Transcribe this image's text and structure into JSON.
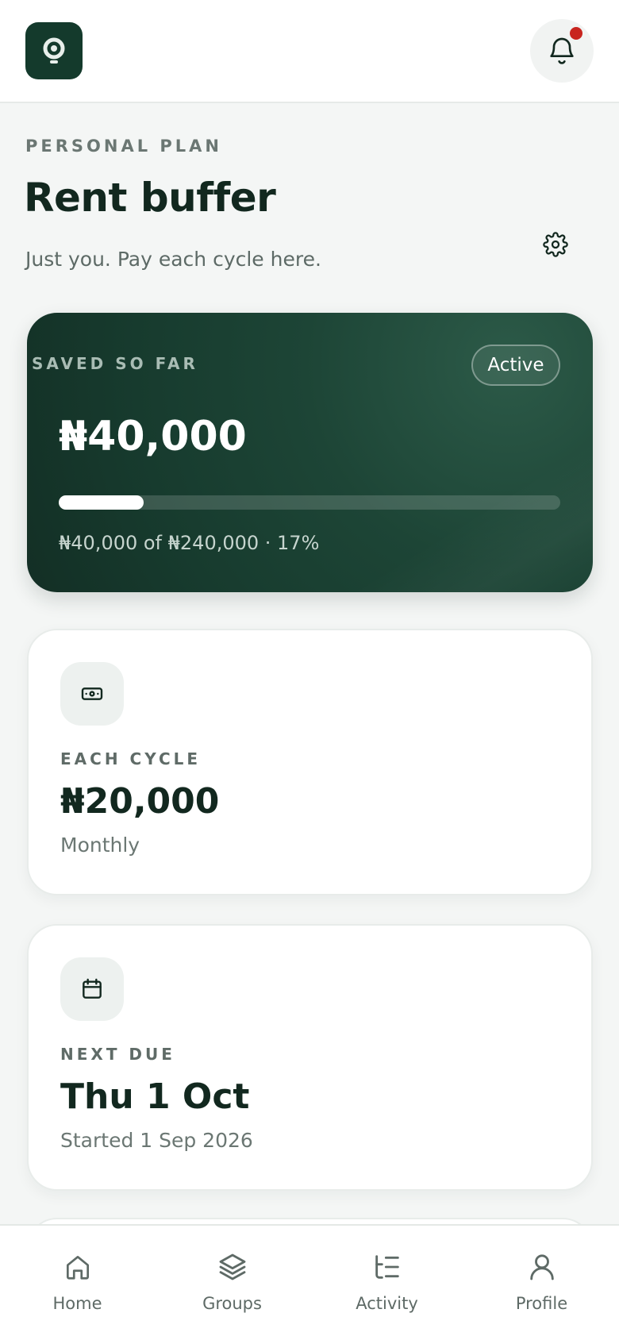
{
  "header": {
    "logo_icon": "app-logo-icon",
    "notification_icon": "bell-icon",
    "has_unread": true
  },
  "plan": {
    "eyebrow": "PERSONAL PLAN",
    "title": "Rent buffer",
    "subtitle": "Just you. Pay each cycle here.",
    "settings_icon": "gear-icon"
  },
  "saved": {
    "label": "SAVED SO FAR",
    "status": "Active",
    "amount": "₦40,000",
    "progress_fraction": 0.17,
    "progress_text": "₦40,000 of ₦240,000 · 17%"
  },
  "cycle": {
    "icon": "cash-icon",
    "label": "EACH CYCLE",
    "value": "₦20,000",
    "sub": "Monthly"
  },
  "next_due": {
    "icon": "calendar-icon",
    "label": "NEXT DUE",
    "value": "Thu 1 Oct",
    "sub": "Started 1 Sep 2026"
  },
  "nav": [
    {
      "label": "Home",
      "icon": "home-icon"
    },
    {
      "label": "Groups",
      "icon": "layers-icon"
    },
    {
      "label": "Activity",
      "icon": "activity-list-icon"
    },
    {
      "label": "Profile",
      "icon": "user-icon"
    }
  ],
  "colors": {
    "brand": "#143a2c",
    "card_dark": "#173b2e",
    "notification_dot": "#c8251f",
    "text_primary": "#12281f",
    "text_muted": "#6b7773"
  }
}
